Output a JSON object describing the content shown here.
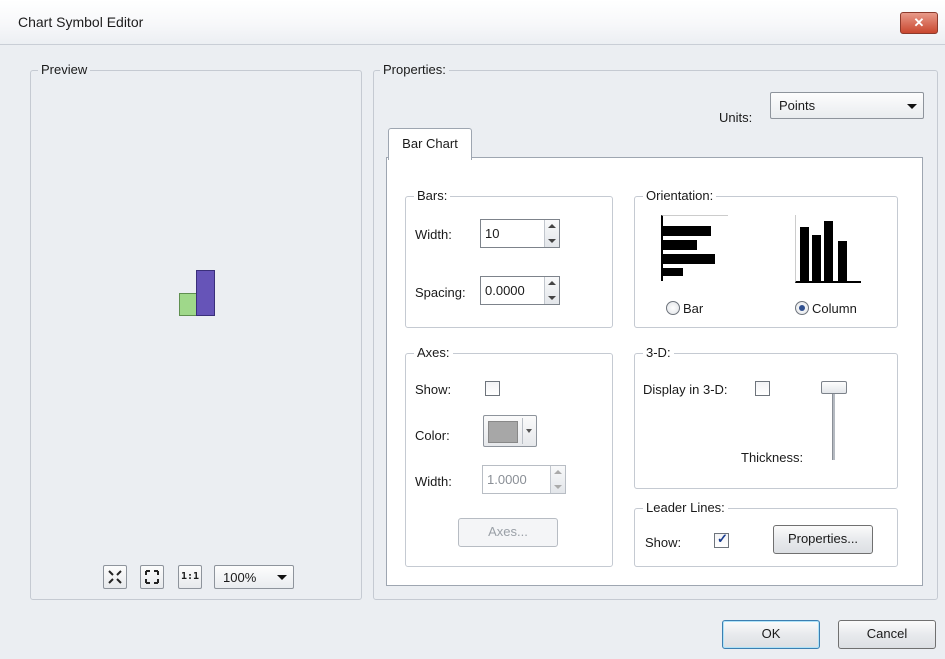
{
  "window": {
    "title": "Chart Symbol Editor",
    "close_glyph": "✕"
  },
  "preview": {
    "label": "Preview",
    "zoom_value": "100%",
    "tools": [
      "zoom-to-fit-icon",
      "full-extent-icon",
      "actual-size-icon"
    ],
    "actual_size_glyph": "1:1",
    "bar_colors": [
      "#9fd88a",
      "#6654b8"
    ]
  },
  "properties": {
    "label": "Properties:",
    "units_label": "Units:",
    "units_value": "Points",
    "tab_label": "Bar Chart",
    "bars": {
      "label": "Bars:",
      "width_label": "Width:",
      "width_value": "10",
      "spacing_label": "Spacing:",
      "spacing_value": "0.0000"
    },
    "orientation": {
      "label": "Orientation:",
      "bar_label": "Bar",
      "column_label": "Column",
      "selected": "Column"
    },
    "axes": {
      "label": "Axes:",
      "show_label": "Show:",
      "show_checked": false,
      "color_label": "Color:",
      "color_swatch": "#a7a7a7",
      "width_label": "Width:",
      "width_value": "1.0000",
      "button_label": "Axes..."
    },
    "three_d": {
      "label": "3-D:",
      "display_label": "Display in 3-D:",
      "display_checked": false,
      "thickness_label": "Thickness:"
    },
    "leader_lines": {
      "label": "Leader Lines:",
      "show_label": "Show:",
      "show_checked": true,
      "button_label": "Properties..."
    }
  },
  "footer": {
    "ok_label": "OK",
    "cancel_label": "Cancel"
  }
}
